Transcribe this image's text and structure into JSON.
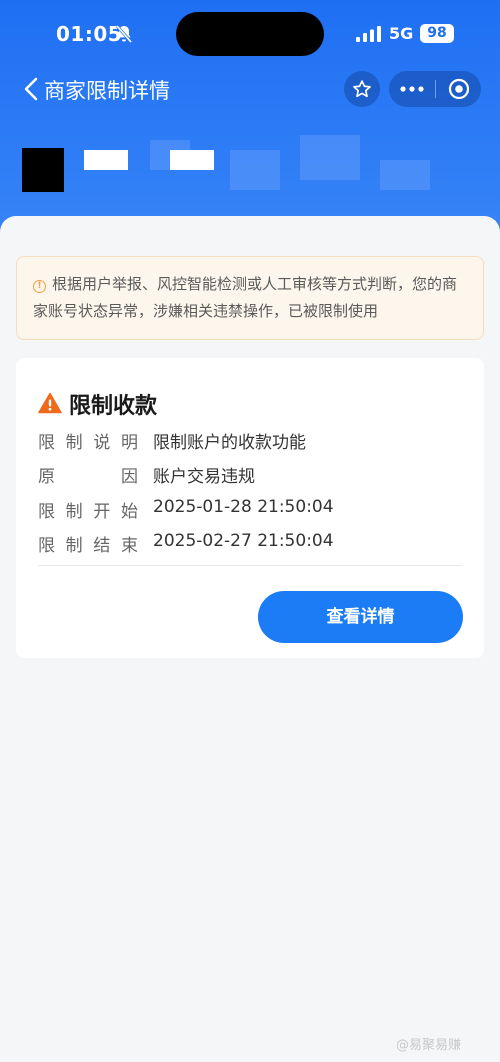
{
  "status_bar": {
    "time": "01:05",
    "network": "5G",
    "battery": "98"
  },
  "nav": {
    "title": "商家限制详情"
  },
  "notice": {
    "text": "根据用户举报、风控智能检测或人工审核等方式判断，您的商家账号状态异常，涉嫌相关违禁操作，已被限制使用"
  },
  "card": {
    "title": "限制收款",
    "rows": [
      {
        "label_chars": [
          "限",
          "制",
          "说",
          "明"
        ],
        "value": "限制账户的收款功能"
      },
      {
        "label_chars": [
          "原",
          "因"
        ],
        "value": "账户交易违规"
      },
      {
        "label_chars": [
          "限",
          "制",
          "开",
          "始"
        ],
        "value": "2025-01-28 21:50:04"
      },
      {
        "label_chars": [
          "限",
          "制",
          "结",
          "束"
        ],
        "value": "2025-02-27 21:50:04"
      }
    ],
    "button_label": "查看详情"
  },
  "watermark": "@易聚易赚",
  "colors": {
    "brand_blue": "#1b7cf5",
    "warning_orange": "#f06a1c",
    "notice_bg": "#fdf6ec"
  }
}
